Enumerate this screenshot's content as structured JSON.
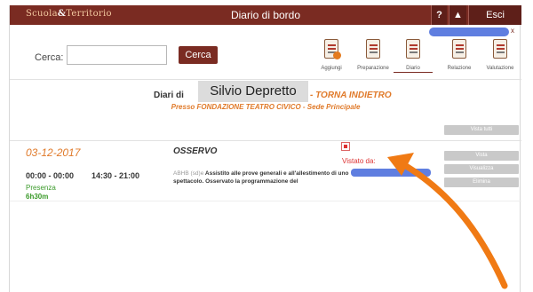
{
  "header": {
    "logo_left": "Scuola",
    "logo_amp": "&",
    "logo_right": "Territorio",
    "title": "Diario di bordo",
    "help_label": "?",
    "user_label": "▲",
    "exit_label": "Esci",
    "user_close": "x"
  },
  "search": {
    "label": "Cerca:",
    "value": "",
    "placeholder": "",
    "button_label": "Cerca"
  },
  "nav": {
    "items": [
      {
        "label": "Aggiungi",
        "icon": "add-document-icon",
        "active": false
      },
      {
        "label": "Preparazione",
        "icon": "preparation-icon",
        "active": false
      },
      {
        "label": "Diario",
        "icon": "diary-icon",
        "active": true
      },
      {
        "label": "Relazione",
        "icon": "report-icon",
        "active": false
      },
      {
        "label": "Valutazione",
        "icon": "evaluation-icon",
        "active": false
      }
    ]
  },
  "diary": {
    "heading_prefix": "Diari di",
    "tooltip": "Silvio Depretto",
    "back_link": "- TORNA INDIETRO",
    "location": "Presso FONDAZIONE TEATRO CIVICO - Sede Principale"
  },
  "buttons": {
    "view_all": "Vista tutti",
    "view": "Vista",
    "visualize": "Visualizza",
    "delete": "Elimina"
  },
  "entry": {
    "date": "03-12-2017",
    "activity": "OSSERVO",
    "time_range_1": "00:00 - 00:00",
    "time_range_2": "14:30 - 21:00",
    "status": "Presenza",
    "hours": "6h30m",
    "desc_prefix": "ABHB (sd)e",
    "description": "Assistito alle prove generali e all'allestimento di uno spettacolo. Osservato la programmazione del",
    "seen_by": "Vistato da:"
  },
  "colors": {
    "brand": "#7a2b22",
    "accent_orange": "#e07a2a",
    "redact_blue": "#5f7ee0",
    "status_green": "#3a9a2a"
  }
}
